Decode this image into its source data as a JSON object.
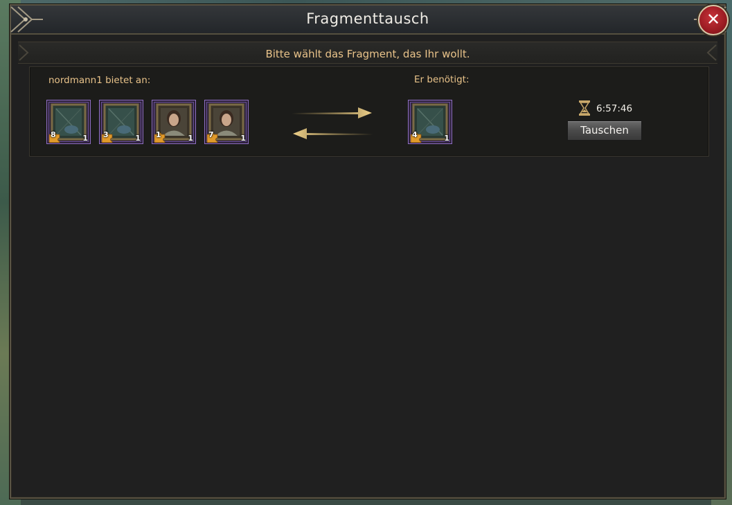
{
  "window": {
    "title": "Fragmenttausch",
    "close_icon": "close-icon",
    "instruction": "Bitte wählt das Fragment, das Ihr wollt."
  },
  "trade": {
    "offer_label": "nordmann1 bietet an:",
    "need_label": "Er benötigt:",
    "offered_items": [
      {
        "art": "painting-frame",
        "badge": "8",
        "qty": "1"
      },
      {
        "art": "painting-frame",
        "badge": "3",
        "qty": "1"
      },
      {
        "art": "portrait-woman",
        "badge": "1",
        "qty": "1"
      },
      {
        "art": "portrait-woman",
        "badge": "7",
        "qty": "1"
      }
    ],
    "needed_items": [
      {
        "art": "painting-frame",
        "badge": "4",
        "qty": "1"
      }
    ],
    "timer_icon": "hourglass-icon",
    "timer": "6:57:46",
    "button_label": "Tauschen"
  },
  "colors": {
    "accent_text": "#e9c38a",
    "item_border": "#8f6fc4",
    "close_button": "#b0252c"
  }
}
